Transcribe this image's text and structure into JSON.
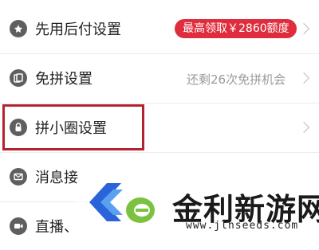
{
  "settings": {
    "items": [
      {
        "label": "先用后付设置",
        "badge": "最高领取￥2860额度",
        "icon": "pay-later-icon"
      },
      {
        "label": "免拼设置",
        "detail": "还剩26次免拼机会",
        "icon": "free-group-icon"
      },
      {
        "label": "拼小圈设置",
        "icon": "lock-icon"
      },
      {
        "label": "消息接",
        "icon": "message-icon"
      },
      {
        "label": "直播、",
        "icon": "live-icon"
      }
    ]
  },
  "watermark": {
    "title": "金利新游网",
    "url": "www.jlnseeds.com"
  },
  "colors": {
    "badge": "#e02d3d",
    "highlight": "#b42230",
    "logo_blue": "#2b63d8",
    "logo_green": "#7cc241"
  }
}
